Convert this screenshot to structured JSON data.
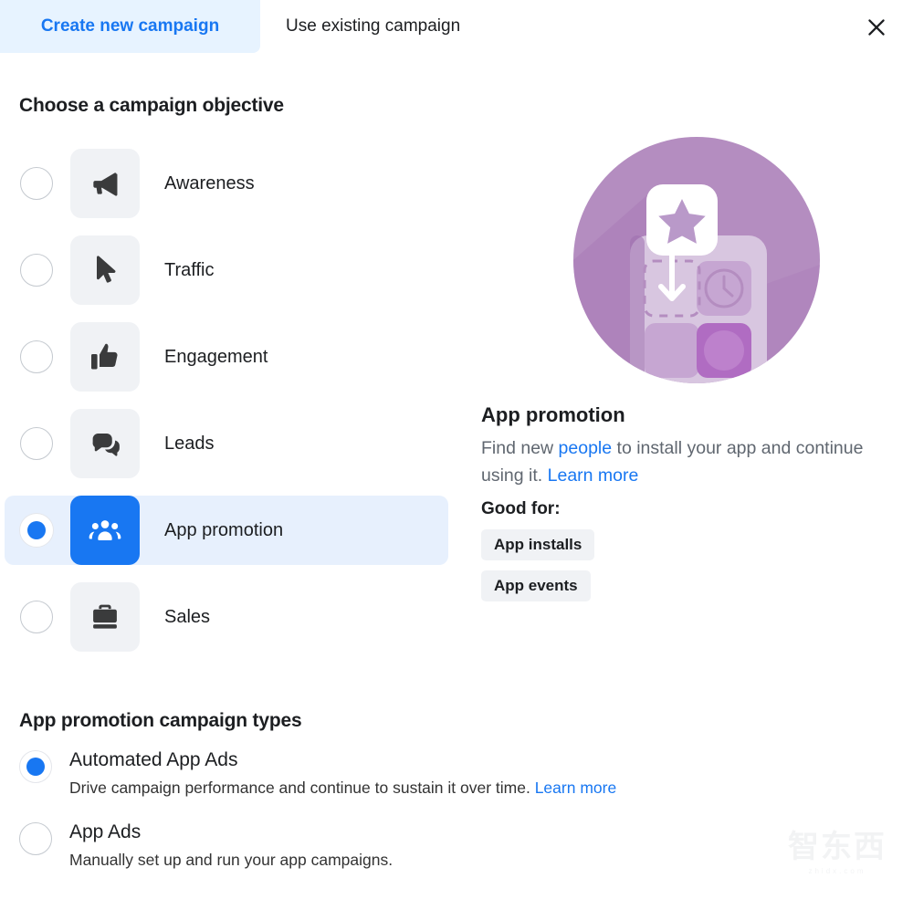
{
  "header": {
    "tabs": [
      {
        "label": "Create new campaign",
        "active": true
      },
      {
        "label": "Use existing campaign",
        "active": false
      }
    ],
    "close_label": "Close"
  },
  "objective_section": {
    "title": "Choose a campaign objective",
    "items": [
      {
        "label": "Awareness",
        "icon": "megaphone-icon",
        "selected": false
      },
      {
        "label": "Traffic",
        "icon": "cursor-icon",
        "selected": false
      },
      {
        "label": "Engagement",
        "icon": "thumbs-up-icon",
        "selected": false
      },
      {
        "label": "Leads",
        "icon": "chat-bubbles-icon",
        "selected": false
      },
      {
        "label": "App promotion",
        "icon": "people-group-icon",
        "selected": true
      },
      {
        "label": "Sales",
        "icon": "briefcase-icon",
        "selected": false
      }
    ]
  },
  "detail": {
    "illustration": "app-promotion-illustration",
    "heading": "App promotion",
    "desc_part1": "Find new ",
    "desc_link1": "people",
    "desc_part2": " to install your app and continue using it. ",
    "desc_link2": "Learn more",
    "good_for_label": "Good for:",
    "badges": [
      "App installs",
      "App events"
    ]
  },
  "types_section": {
    "title": "App promotion campaign types",
    "items": [
      {
        "title": "Automated App Ads",
        "desc": "Drive campaign performance and continue to sustain it over time. ",
        "link": "Learn more",
        "selected": true
      },
      {
        "title": "App Ads",
        "desc": "Manually set up and run your app campaigns.",
        "link": "",
        "selected": false
      }
    ]
  },
  "watermark": {
    "chars": "智东西",
    "sub": "zhidx.com"
  },
  "colors": {
    "accent": "#1877f2",
    "tab_active_bg": "#e7f3ff",
    "selected_row_bg": "#e7f0fd",
    "tile_bg": "#f0f2f5",
    "illustration_circle": "#b48dc0"
  }
}
